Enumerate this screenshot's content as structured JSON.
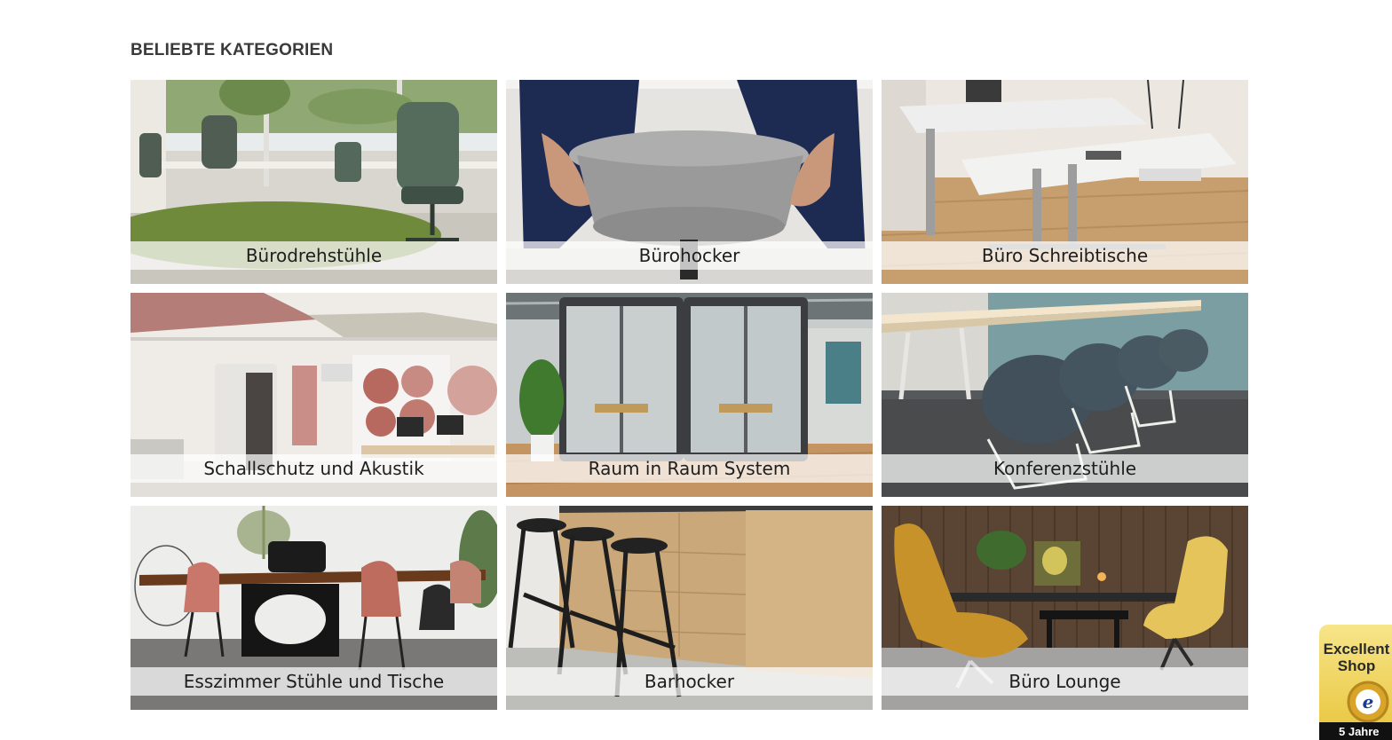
{
  "section": {
    "title": "BELIEBTE KATEGORIEN"
  },
  "categories": [
    {
      "label": "Bürodrehstühle",
      "image": "office-swivel-chairs-photo"
    },
    {
      "label": "Bürohocker",
      "image": "office-stool-photo"
    },
    {
      "label": "Büro Schreibtische",
      "image": "office-desks-photo"
    },
    {
      "label": "Schallschutz und Akustik",
      "image": "acoustic-panels-photo"
    },
    {
      "label": "Raum in Raum System",
      "image": "room-in-room-booth-photo"
    },
    {
      "label": "Konferenzstühle",
      "image": "conference-chairs-photo"
    },
    {
      "label": "Esszimmer Stühle und Tische",
      "image": "dining-chairs-tables-photo"
    },
    {
      "label": "Barhocker",
      "image": "bar-stools-photo"
    },
    {
      "label": "Büro Lounge",
      "image": "office-lounge-photo"
    }
  ],
  "trust_badge": {
    "title": "Excellent Shop",
    "seal": "e",
    "footer": "5 Jahre"
  }
}
